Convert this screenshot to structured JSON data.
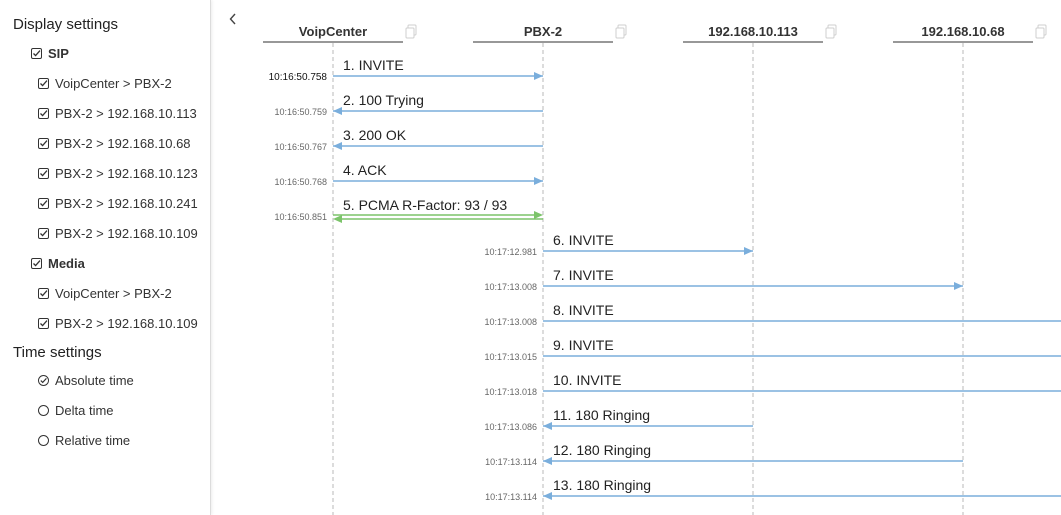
{
  "sidebar": {
    "display_title": "Display settings",
    "sip_label": "SIP",
    "sip_items": [
      "VoipCenter > PBX-2",
      "PBX-2 > 192.168.10.113",
      "PBX-2 > 192.168.10.68",
      "PBX-2 > 192.168.10.123",
      "PBX-2 > 192.168.10.241",
      "PBX-2 > 192.168.10.109"
    ],
    "media_label": "Media",
    "media_items": [
      "VoipCenter > PBX-2",
      "PBX-2 > 192.168.10.109"
    ],
    "time_title": "Time settings",
    "time_options": [
      {
        "label": "Absolute time",
        "selected": true
      },
      {
        "label": "Delta time",
        "selected": false
      },
      {
        "label": "Relative time",
        "selected": false
      }
    ]
  },
  "participants": [
    "VoipCenter",
    "PBX-2",
    "192.168.10.113",
    "192.168.10.68"
  ],
  "messages": [
    {
      "label": "1. INVITE",
      "time": "10:16:50.758",
      "from": 0,
      "to": 1,
      "color": "#7aaedc",
      "highlight": true
    },
    {
      "label": "2. 100 Trying",
      "time": "10:16:50.759",
      "from": 1,
      "to": 0,
      "color": "#7aaedc"
    },
    {
      "label": "3. 200 OK",
      "time": "10:16:50.767",
      "from": 1,
      "to": 0,
      "color": "#7aaedc"
    },
    {
      "label": "4. ACK",
      "time": "10:16:50.768",
      "from": 0,
      "to": 1,
      "color": "#7aaedc"
    },
    {
      "label": "5. PCMA R-Factor: 93 / 93",
      "time": "10:16:50.851",
      "from": 0,
      "to": 1,
      "color": "#7cc46a",
      "media": true
    },
    {
      "label": "6. INVITE",
      "time": "10:17:12.981",
      "from": 1,
      "to": 2,
      "color": "#7aaedc"
    },
    {
      "label": "7. INVITE",
      "time": "10:17:13.008",
      "from": 1,
      "to": 3,
      "color": "#7aaedc"
    },
    {
      "label": "8. INVITE",
      "time": "10:17:13.008",
      "from": 1,
      "to": 4,
      "color": "#7aaedc"
    },
    {
      "label": "9. INVITE",
      "time": "10:17:13.015",
      "from": 1,
      "to": 4,
      "color": "#7aaedc"
    },
    {
      "label": "10. INVITE",
      "time": "10:17:13.018",
      "from": 1,
      "to": 4,
      "color": "#7aaedc"
    },
    {
      "label": "11. 180 Ringing",
      "time": "10:17:13.086",
      "from": 2,
      "to": 1,
      "color": "#7aaedc"
    },
    {
      "label": "12. 180 Ringing",
      "time": "10:17:13.114",
      "from": 3,
      "to": 1,
      "color": "#7aaedc"
    },
    {
      "label": "13. 180 Ringing",
      "time": "10:17:13.114",
      "from": 4,
      "to": 1,
      "color": "#7aaedc"
    }
  ],
  "colors": {
    "sip_arrow": "#7aaedc",
    "media_arrow": "#7cc46a",
    "lifeline": "#b8b8b8"
  }
}
